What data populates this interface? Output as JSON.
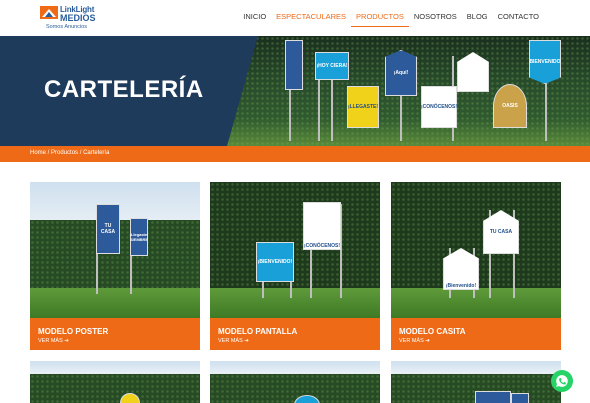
{
  "brand": {
    "line1": "LinkLight",
    "line2": "MEDIOS",
    "tagline": "Somos Anuncios",
    "accent": "#ee6a17",
    "navy": "#1f3b5c"
  },
  "nav": {
    "items": [
      {
        "label": "INICIO"
      },
      {
        "label": "ESPECTACULARES"
      },
      {
        "label": "PRODUCTOS"
      },
      {
        "label": "NOSOTROS"
      },
      {
        "label": "BLOG"
      },
      {
        "label": "CONTACTO"
      }
    ]
  },
  "hero": {
    "title": "CARTELERÍA",
    "signs": [
      "¡HOY CIERA!",
      "¡LLEGASTE!",
      "¡Aquí!",
      "¡CONÓCENOS!",
      "¡BIENVENIDO!",
      "OASIS"
    ]
  },
  "breadcrumb": {
    "home": "Home",
    "sep1": " / ",
    "products": "Productos",
    "sep2": " / ",
    "current": "Cartelería"
  },
  "cards": [
    {
      "title": "MODELO POSTER",
      "more": "VER MÁS ➔",
      "sign_a": "TU CASA",
      "sign_b": "¡Llegaste! SIEMBRE"
    },
    {
      "title": "MODELO PANTALLA",
      "more": "VER MÁS ➔",
      "sign_a": "¡CONÓCENOS!",
      "sign_b": "¡BIENVENIDO!"
    },
    {
      "title": "MODELO CASITA",
      "more": "VER MÁS ➔",
      "sign_a": "TU CASA",
      "sign_b": "¡Bienvenido!"
    }
  ],
  "icons": {
    "whatsapp": "whatsapp-icon"
  }
}
